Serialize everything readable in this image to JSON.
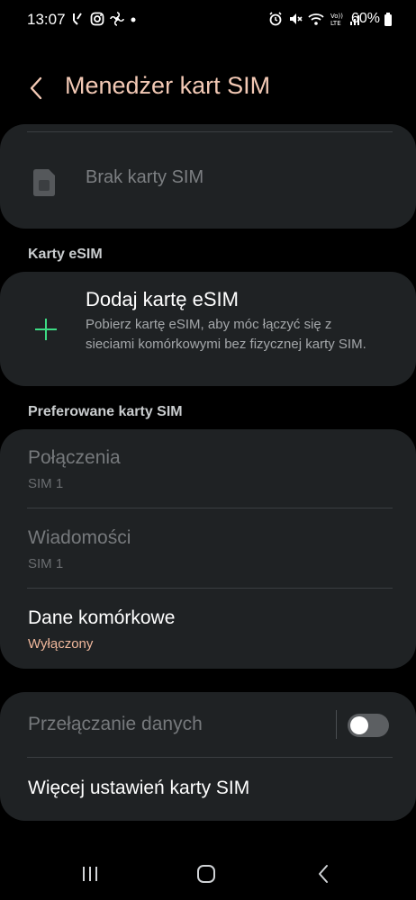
{
  "status_bar": {
    "time": "13:07",
    "battery": "60%",
    "left_icons": [
      "missed-call-icon",
      "instagram-icon",
      "settings-pinwheel-icon",
      "dot-icon"
    ],
    "right_icons": [
      "alarm-icon",
      "mute-icon",
      "wifi-icon",
      "volte-icon",
      "signal-icon",
      "battery-icon"
    ]
  },
  "header": {
    "title": "Menedżer kart SIM"
  },
  "sim_card": {
    "label": "Brak karty SIM"
  },
  "esim_section": {
    "label": "Karty eSIM",
    "add_title": "Dodaj kartę eSIM",
    "add_description": "Pobierz kartę eSIM, aby móc łączyć się z sieciami komórkowymi bez fizycznej karty SIM."
  },
  "preferred_section": {
    "label": "Preferowane karty SIM",
    "items": [
      {
        "title": "Połączenia",
        "value": "SIM 1"
      },
      {
        "title": "Wiadomości",
        "value": "SIM 1"
      },
      {
        "title": "Dane komórkowe",
        "value": "Wyłączony"
      }
    ]
  },
  "more_section": {
    "data_switching": "Przełączanie danych",
    "data_switching_on": false,
    "more_settings": "Więcej ustawień karty SIM"
  },
  "colors": {
    "accent": "#f3c9b5",
    "value_accent": "#f0b89c",
    "plus_green": "#3ddc84",
    "card_bg": "#1f2224"
  }
}
